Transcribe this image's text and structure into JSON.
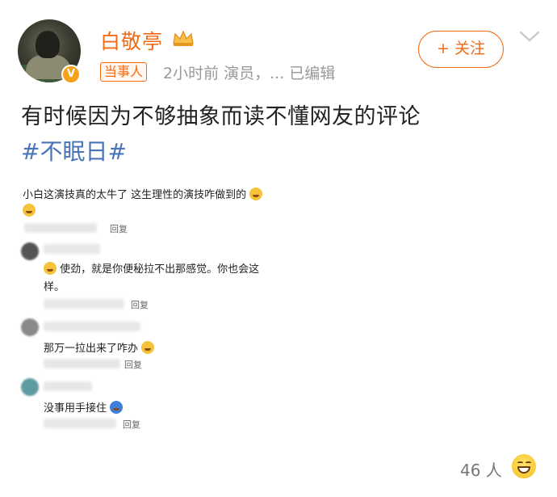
{
  "post": {
    "author": {
      "name": "白敬亭",
      "tag": "当事人",
      "verified_badge": "V"
    },
    "meta": "2小时前  演员，... 已编辑",
    "follow_label": "+ 关注",
    "text": "有时候因为不够抽象而读不懂网友的评论",
    "hashtag": "#不眠日#"
  },
  "screenshot": {
    "comment": "小白这演技真的太牛了 这生理性的演技咋做到的",
    "reply_label": "回复",
    "replies": [
      {
        "text_line1": "使劲，就是你便秘拉不出那感觉。你也会这",
        "text_line2": "样。"
      },
      {
        "text_line1": "那万一拉出来了咋办"
      },
      {
        "text_line1": "没事用手接住"
      }
    ]
  },
  "footer": {
    "count": "46 人"
  },
  "colors": {
    "accent": "#f26a12",
    "link": "#4a74b8",
    "meta": "#999999"
  }
}
